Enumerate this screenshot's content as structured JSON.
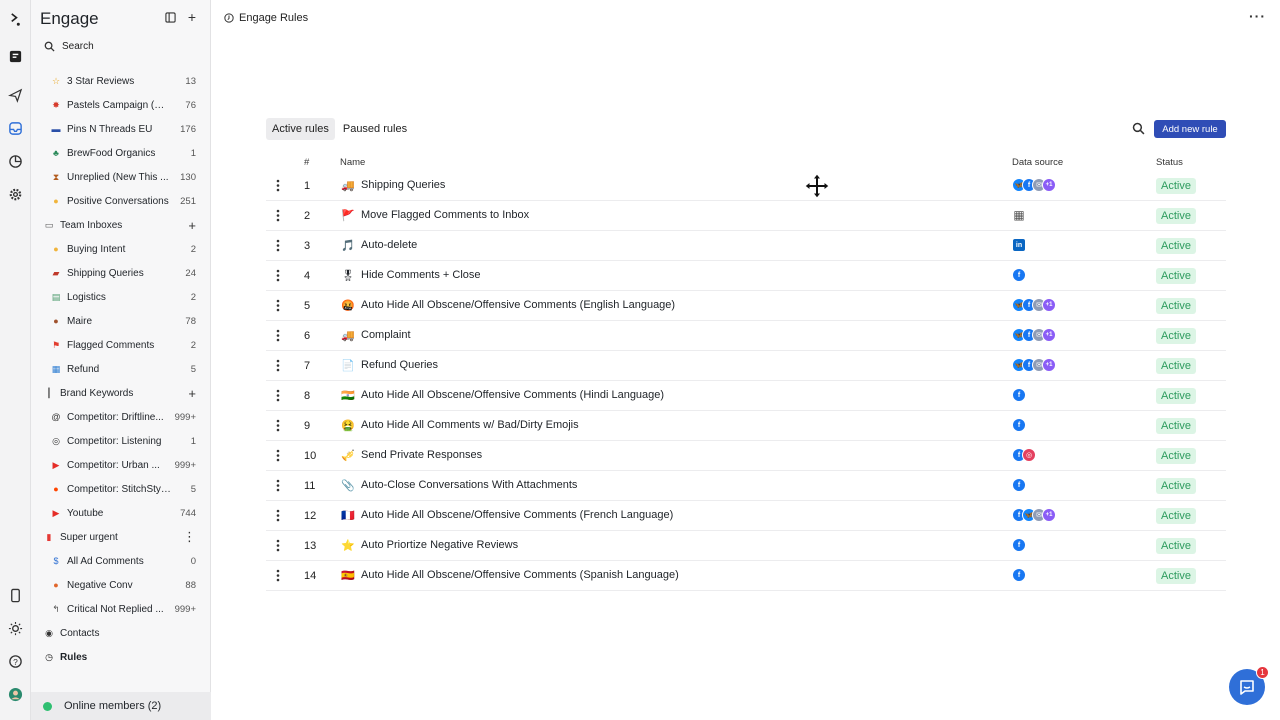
{
  "app": {
    "title": "Engage",
    "breadcrumb": "Engage Rules"
  },
  "sidebar": {
    "search_label": "Search",
    "items": [
      {
        "label": "3 Star Reviews",
        "count": "13",
        "icon": "star-icon",
        "kind": "item"
      },
      {
        "label": "Pastels Campaign (UTM)",
        "count": "76",
        "icon": "leaf-icon",
        "kind": "item"
      },
      {
        "label": "Pins N Threads EU",
        "count": "176",
        "icon": "flag-eu-icon",
        "kind": "item"
      },
      {
        "label": "BrewFood Organics",
        "count": "1",
        "icon": "paw-icon",
        "kind": "item"
      },
      {
        "label": "Unreplied (New This ...",
        "count": "130",
        "icon": "hourglass-icon",
        "kind": "item"
      },
      {
        "label": "Positive Conversations",
        "count": "251",
        "icon": "smile-icon",
        "kind": "item"
      },
      {
        "label": "Team Inboxes",
        "count": "+",
        "icon": "inbox-icon",
        "kind": "group"
      },
      {
        "label": "Buying Intent",
        "count": "2",
        "icon": "smile-icon",
        "kind": "item"
      },
      {
        "label": "Shipping Queries",
        "count": "24",
        "icon": "truck-icon",
        "kind": "item"
      },
      {
        "label": "Logistics",
        "count": "2",
        "icon": "box-icon",
        "kind": "item"
      },
      {
        "label": "Maire",
        "count": "78",
        "icon": "avatar-icon",
        "kind": "item"
      },
      {
        "label": "Flagged Comments",
        "count": "2",
        "icon": "red-flag-icon",
        "kind": "item"
      },
      {
        "label": "Refund",
        "count": "5",
        "icon": "money-icon",
        "kind": "item"
      },
      {
        "label": "Brand Keywords",
        "count": "+",
        "icon": "waveform-icon",
        "kind": "group"
      },
      {
        "label": "Competitor: Driftline...",
        "count": "999+",
        "icon": "threads-icon",
        "kind": "item"
      },
      {
        "label": "Competitor: Listening",
        "count": "1",
        "icon": "globe-icon",
        "kind": "item"
      },
      {
        "label": "Competitor: Urban ...",
        "count": "999+",
        "icon": "youtube-icon",
        "kind": "item"
      },
      {
        "label": "Competitor: StitchStyleCo",
        "count": "5",
        "icon": "reddit-icon",
        "kind": "item"
      },
      {
        "label": "Youtube",
        "count": "744",
        "icon": "youtube-icon",
        "kind": "item"
      },
      {
        "label": "Super urgent",
        "count": "⋮",
        "icon": "red-dot-icon",
        "kind": "group"
      },
      {
        "label": "All Ad Comments",
        "count": "0",
        "icon": "dollar-icon",
        "kind": "item"
      },
      {
        "label": "Negative Conv",
        "count": "88",
        "icon": "angry-icon",
        "kind": "item"
      },
      {
        "label": "Critical Not Replied ...",
        "count": "999+",
        "icon": "reply-icon",
        "kind": "item"
      },
      {
        "label": "Contacts",
        "count": "",
        "icon": "contacts-icon",
        "kind": "group"
      },
      {
        "label": "Rules",
        "count": "",
        "icon": "rules-icon",
        "kind": "group-bold"
      }
    ],
    "footer_label": "Online members (2)"
  },
  "tabs": [
    {
      "label": "Active rules",
      "active": true
    },
    {
      "label": "Paused rules",
      "active": false
    }
  ],
  "add_button_label": "Add new rule",
  "table": {
    "headers": {
      "num": "#",
      "name": "Name",
      "source": "Data source",
      "status": "Status"
    },
    "rows": [
      {
        "num": "1",
        "emoji": "🚚",
        "name": "Shipping Queries",
        "sources": [
          "bs",
          "fb",
          "gr",
          "pl"
        ],
        "status": "Active"
      },
      {
        "num": "2",
        "emoji": "🚩",
        "name": "Move Flagged Comments to Inbox",
        "sources": [
          "bld"
        ],
        "status": "Active"
      },
      {
        "num": "3",
        "emoji": "🎵",
        "name": "Auto-delete",
        "sources": [
          "li"
        ],
        "status": "Active"
      },
      {
        "num": "4",
        "emoji": "🎖",
        "name": "Hide Comments + Close",
        "sources": [
          "fb"
        ],
        "status": "Active"
      },
      {
        "num": "5",
        "emoji": "🤬",
        "name": "Auto Hide All Obscene/Offensive Comments (English Language)",
        "sources": [
          "bs",
          "fb",
          "gr",
          "pl"
        ],
        "status": "Active"
      },
      {
        "num": "6",
        "emoji": "🚚",
        "name": "Complaint",
        "sources": [
          "bs",
          "fb",
          "gr",
          "pl"
        ],
        "status": "Active"
      },
      {
        "num": "7",
        "emoji": "📄",
        "name": "Refund Queries",
        "sources": [
          "bs",
          "fb",
          "gr",
          "pl"
        ],
        "status": "Active"
      },
      {
        "num": "8",
        "emoji": "🇮🇳",
        "name": "Auto Hide All Obscene/Offensive Comments (Hindi Language)",
        "sources": [
          "fb"
        ],
        "status": "Active"
      },
      {
        "num": "9",
        "emoji": "🤮",
        "name": "Auto Hide All Comments w/ Bad/Dirty Emojis",
        "sources": [
          "fb"
        ],
        "status": "Active"
      },
      {
        "num": "10",
        "emoji": "🎺",
        "name": "Send Private Responses",
        "sources": [
          "fb",
          "ig"
        ],
        "status": "Active"
      },
      {
        "num": "11",
        "emoji": "📎",
        "name": "Auto-Close Conversations With Attachments",
        "sources": [
          "fb"
        ],
        "status": "Active"
      },
      {
        "num": "12",
        "emoji": "🇫🇷",
        "name": "Auto Hide All Obscene/Offensive Comments (French Language)",
        "sources": [
          "fb",
          "bs",
          "gr",
          "pl"
        ],
        "status": "Active"
      },
      {
        "num": "13",
        "emoji": "⭐",
        "name": "Auto Priortize Negative Reviews",
        "sources": [
          "fb"
        ],
        "status": "Active"
      },
      {
        "num": "14",
        "emoji": "🇪🇸",
        "name": "Auto Hide All Obscene/Offensive Comments (Spanish Language)",
        "sources": [
          "fb"
        ],
        "status": "Active"
      }
    ]
  },
  "source_glyphs": {
    "fb": "f",
    "bs": "🦋",
    "gr": "✉",
    "pl": "+1",
    "li": "in",
    "ig": "◎",
    "bld": "▦"
  },
  "chat_notification_count": "1",
  "colors": {
    "accent": "#2f4db6",
    "active_bg": "#dcf5e5",
    "active_text": "#2e9b5e"
  }
}
